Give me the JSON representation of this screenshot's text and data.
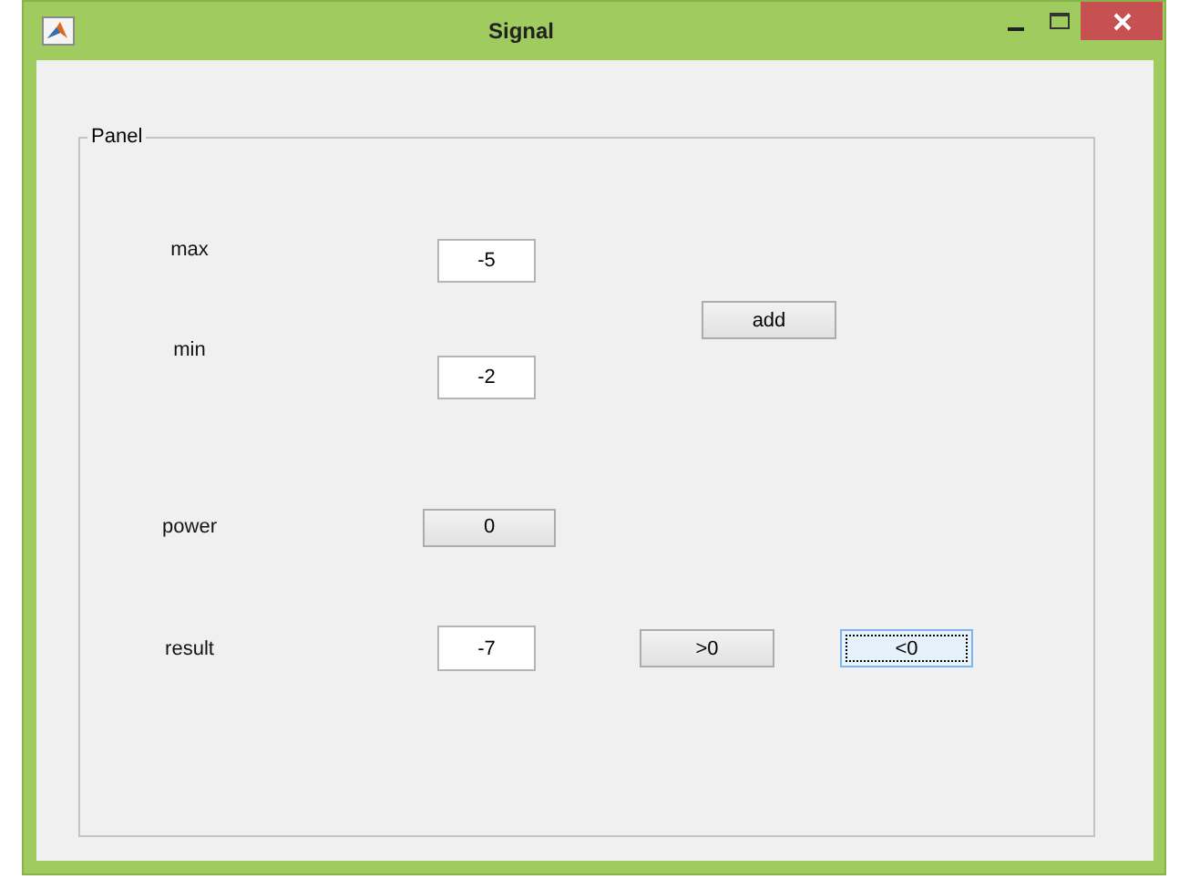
{
  "window": {
    "title": "Signal"
  },
  "panel": {
    "title": "Panel",
    "labels": [
      "max",
      "min",
      "power",
      "result"
    ],
    "fields": [
      {
        "value": "-5"
      },
      {
        "value": "-2"
      },
      {
        "value": "-7"
      }
    ],
    "buttons": [
      {
        "label": "add",
        "focused": false
      },
      {
        "label": "0",
        "focused": false
      },
      {
        "label": ">0",
        "focused": false
      },
      {
        "label": "<0",
        "focused": true
      }
    ]
  }
}
